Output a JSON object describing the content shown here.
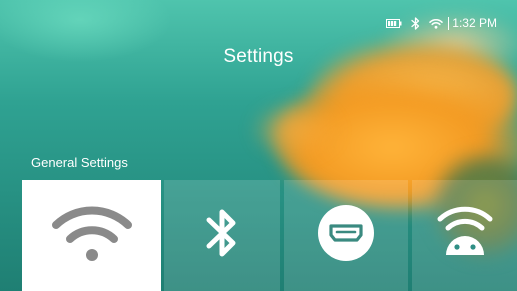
{
  "status_bar": {
    "time": "1:32 PM",
    "icons": [
      "battery-icon",
      "bluetooth-icon",
      "wifi-icon"
    ]
  },
  "page": {
    "title": "Settings",
    "section_label": "General Settings"
  },
  "tiles": [
    {
      "icon": "wifi-icon",
      "selected": true
    },
    {
      "icon": "bluetooth-icon",
      "selected": false
    },
    {
      "icon": "hdmi-icon",
      "selected": false
    },
    {
      "icon": "android-wifi-icon",
      "selected": false
    }
  ],
  "colors": {
    "selected_tile": "#ffffff",
    "selected_icon": "#8a8a8a",
    "text": "#ffffff"
  }
}
